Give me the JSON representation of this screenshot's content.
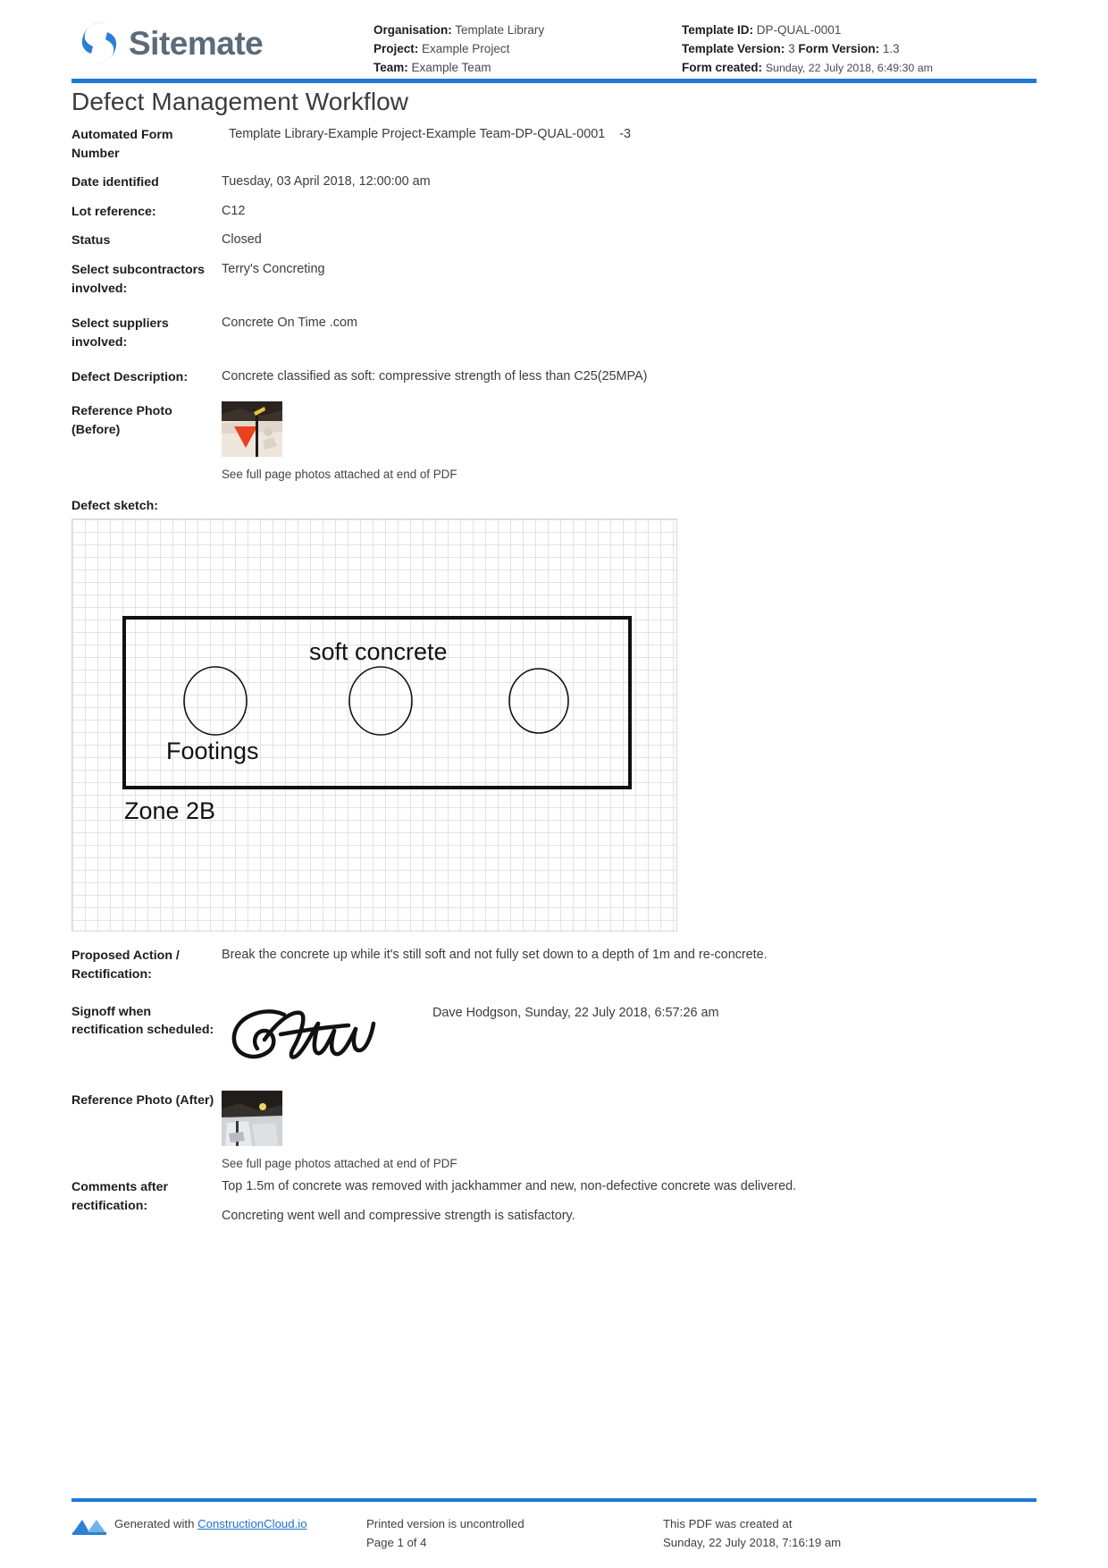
{
  "brand": {
    "name": "Sitemate",
    "logo_icon": "sitemate-logo-icon"
  },
  "header": {
    "left": [
      {
        "label": "Organisation:",
        "value": "Template Library"
      },
      {
        "label": "Project:",
        "value": "Example Project"
      },
      {
        "label": "Team:",
        "value": "Example Team"
      }
    ],
    "right": {
      "template_id_label": "Template ID:",
      "template_id_value": "DP-QUAL-0001",
      "template_version_label": "Template Version:",
      "template_version_value": "3",
      "form_version_label": "Form Version:",
      "form_version_value": "1.3",
      "form_created_label": "Form created:",
      "form_created_value": "Sunday, 22 July 2018, 6:49:30 am"
    },
    "accent_color": "#1f7ad4"
  },
  "document": {
    "title": "Defect Management Workflow"
  },
  "fields": {
    "automated_form_number": {
      "label": "Automated Form Number",
      "value": "Template Library-Example Project-Example Team-DP-QUAL-0001",
      "suffix": "-3"
    },
    "date_identified": {
      "label": "Date identified",
      "value": "Tuesday, 03 April 2018, 12:00:00 am"
    },
    "lot_reference": {
      "label": "Lot reference:",
      "value": "C12"
    },
    "status": {
      "label": "Status",
      "value": "Closed"
    },
    "subcontractors": {
      "label": "Select subcontractors involved:",
      "value": "Terry's Concreting"
    },
    "suppliers": {
      "label": "Select suppliers involved:",
      "value": "Concrete On Time .com"
    },
    "defect_description": {
      "label": "Defect Description:",
      "value": "Concrete classified as soft: compressive strength of less than C25(25MPA)"
    },
    "reference_photo_before": {
      "label": "Reference Photo (Before)",
      "caption": "See full page photos attached at end of PDF",
      "thumb_icon": "photo-thumbnail-before-icon"
    },
    "defect_sketch": {
      "label": "Defect sketch:",
      "annotations": {
        "top": "soft concrete",
        "inner": "Footings",
        "outer": "Zone 2B"
      }
    },
    "proposed_action": {
      "label": "Proposed Action / Rectification:",
      "value": "Break the concrete up while it's still soft and not fully set down to a depth of 1m and re-concrete."
    },
    "signoff": {
      "label": "Signoff when rectification scheduled:",
      "value": "Dave Hodgson, Sunday, 22 July 2018, 6:57:26 am",
      "signature_icon": "handwritten-signature-icon"
    },
    "reference_photo_after": {
      "label": "Reference Photo (After)",
      "caption": "See full page photos attached at end of PDF",
      "thumb_icon": "photo-thumbnail-after-icon"
    },
    "comments_after_rectification": {
      "label": "Comments after rectification:",
      "line1": "Top 1.5m of concrete was removed with jackhammer and new, non-defective concrete was delivered.",
      "line2": "Concreting went well and compressive strength is satisfactory."
    }
  },
  "footer": {
    "generated_with_prefix": "Generated with",
    "generated_with_link": "ConstructionCloud.io",
    "logo_icon": "constructioncloud-logo-icon",
    "uncontrolled_notice": "Printed version is uncontrolled",
    "page_number": "Page 1 of 4",
    "created_at_label": "This PDF was created at",
    "created_at_value": "Sunday, 22 July 2018, 7:16:19 am"
  }
}
